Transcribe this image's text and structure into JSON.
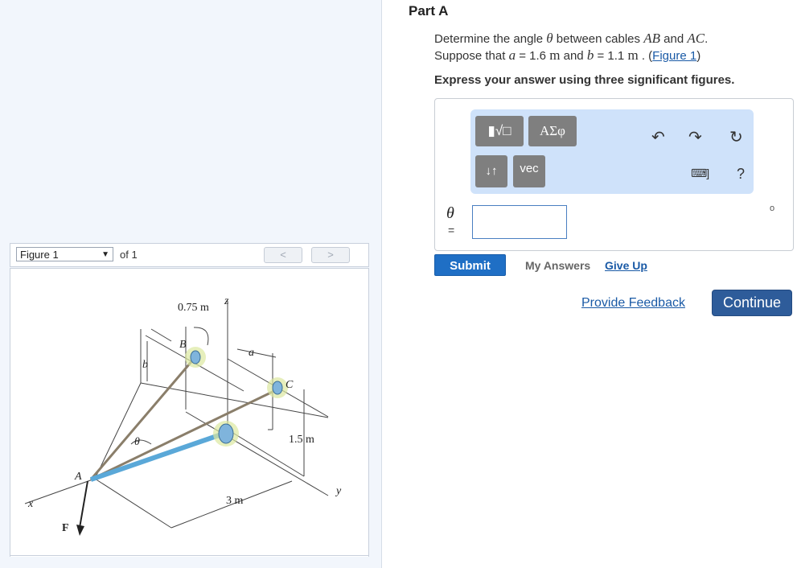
{
  "part": {
    "title": "Part A"
  },
  "question": {
    "line1_prefix": "Determine the angle ",
    "theta": "θ",
    "line1_mid": " between cables ",
    "cable1": "AB",
    "and": " and ",
    "cable2": "AC",
    "period": ".",
    "line2_prefix": "Suppose that ",
    "var_a": "a",
    "a_value": " = 1.6 ",
    "unit_m": "m",
    "and2": " and ",
    "var_b": "b",
    "b_value": " = 1.1 ",
    "unit_m2": "m",
    "dot": " . (",
    "figure_link": "Figure 1",
    "close": ")"
  },
  "instruction": "Express your answer using three significant figures.",
  "toolbar": {
    "templates_label": "▮√□",
    "greek_label": "ΑΣφ",
    "arrows_label": "↓↑",
    "vec_label": "vec",
    "undo_icon": "undo-icon",
    "redo_icon": "redo-icon",
    "reset_icon": "reset-icon",
    "keyboard_icon": "keyboard-icon",
    "help_label": "?"
  },
  "answer": {
    "variable": "θ",
    "equals": "=",
    "value": "",
    "small_mark": "o"
  },
  "buttons": {
    "submit": "Submit",
    "my_answers": "My Answers",
    "give_up": "Give Up",
    "provide_feedback": "Provide Feedback",
    "continue": "Continue"
  },
  "figure": {
    "selector_value": "Figure 1",
    "of_label": "of 1",
    "prev": "<",
    "next": ">",
    "labels": {
      "dim_075": "0.75 m",
      "z": "z",
      "B": "B",
      "a": "a",
      "b": "b",
      "C": "C",
      "theta": "θ",
      "dim_15": "1.5 m",
      "A": "A",
      "x": "x",
      "y": "y",
      "dim_3": "3 m",
      "F": "F"
    }
  }
}
